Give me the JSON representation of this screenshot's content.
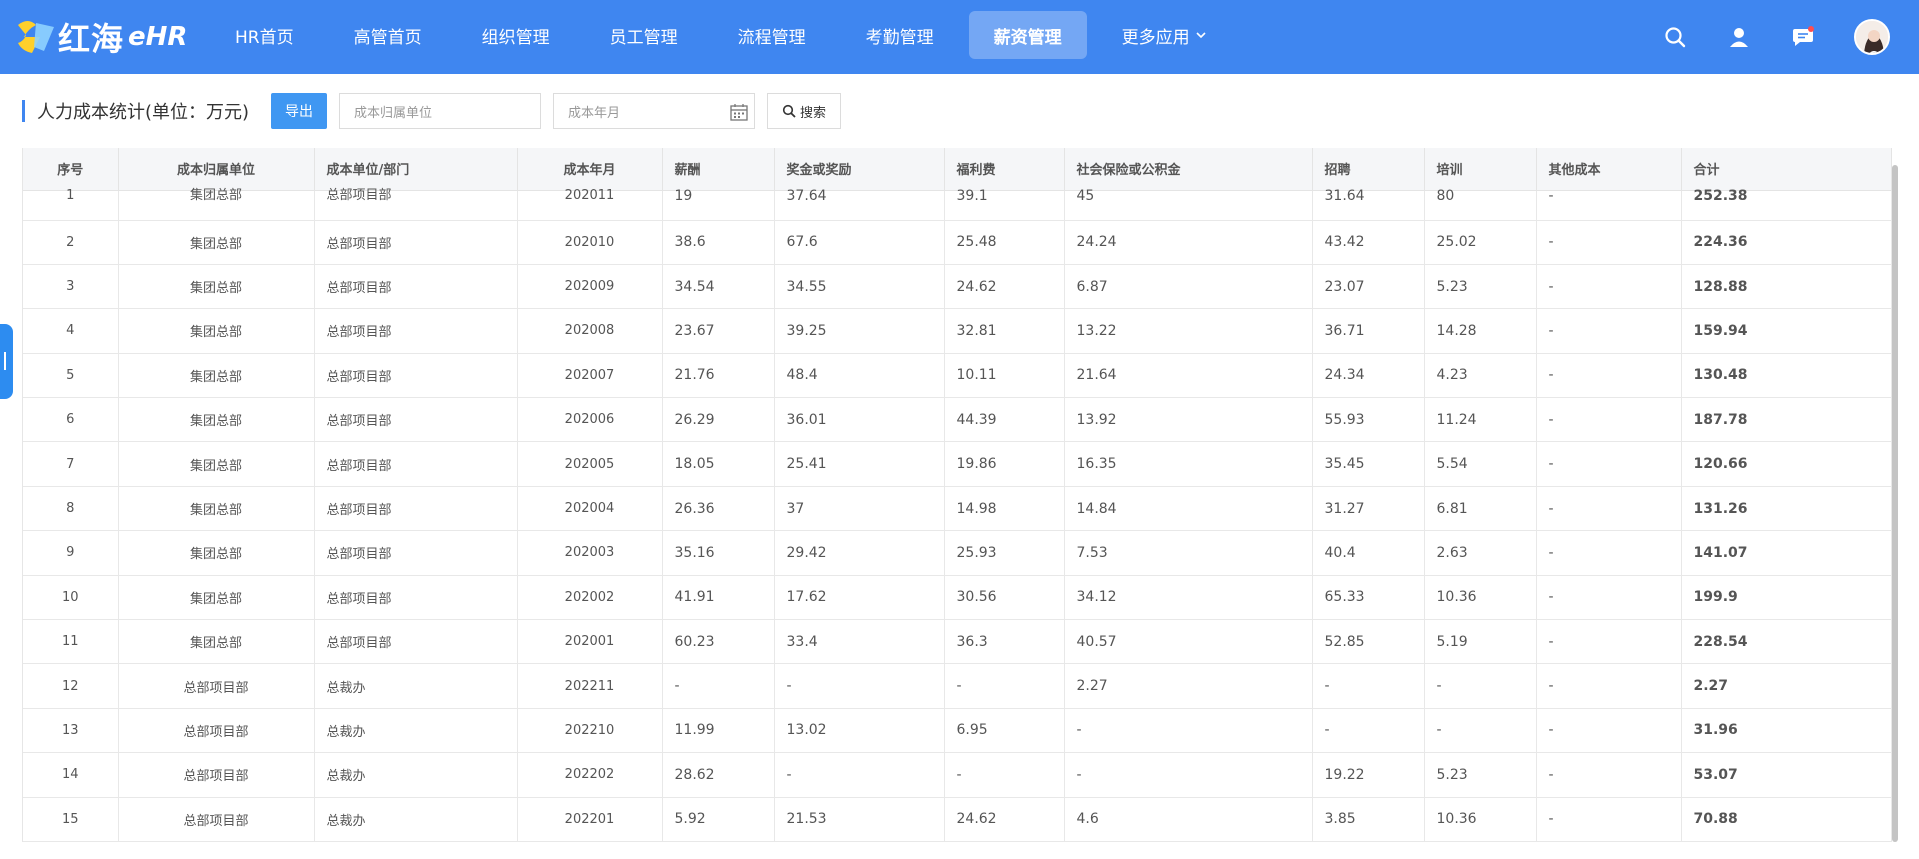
{
  "brand": {
    "name": "红海",
    "suffix": "eHR"
  },
  "nav": {
    "items": [
      {
        "label": "HR首页"
      },
      {
        "label": "高管首页"
      },
      {
        "label": "组织管理"
      },
      {
        "label": "员工管理"
      },
      {
        "label": "流程管理"
      },
      {
        "label": "考勤管理"
      },
      {
        "label": "薪资管理",
        "active": true
      },
      {
        "label": "更多应用"
      }
    ]
  },
  "header_icons": [
    "search-icon",
    "user-icon",
    "message-icon",
    "avatar"
  ],
  "toolbar": {
    "title": "人力成本统计(单位：万元)",
    "export_label": "导出",
    "unit_placeholder": "成本归属单位",
    "month_placeholder": "成本年月",
    "search_label": "搜索"
  },
  "table": {
    "headers": [
      "序号",
      "成本归属单位",
      "成本单位/部门",
      "成本年月",
      "薪酬",
      "奖金或奖励",
      "福利费",
      "社会保险或公积金",
      "招聘",
      "培训",
      "其他成本",
      "合计"
    ],
    "rows": [
      [
        "1",
        "集团总部",
        "总部项目部",
        "202011",
        "19",
        "37.64",
        "39.1",
        "45",
        "31.64",
        "80",
        "-",
        "252.38"
      ],
      [
        "2",
        "集团总部",
        "总部项目部",
        "202010",
        "38.6",
        "67.6",
        "25.48",
        "24.24",
        "43.42",
        "25.02",
        "-",
        "224.36"
      ],
      [
        "3",
        "集团总部",
        "总部项目部",
        "202009",
        "34.54",
        "34.55",
        "24.62",
        "6.87",
        "23.07",
        "5.23",
        "-",
        "128.88"
      ],
      [
        "4",
        "集团总部",
        "总部项目部",
        "202008",
        "23.67",
        "39.25",
        "32.81",
        "13.22",
        "36.71",
        "14.28",
        "-",
        "159.94"
      ],
      [
        "5",
        "集团总部",
        "总部项目部",
        "202007",
        "21.76",
        "48.4",
        "10.11",
        "21.64",
        "24.34",
        "4.23",
        "-",
        "130.48"
      ],
      [
        "6",
        "集团总部",
        "总部项目部",
        "202006",
        "26.29",
        "36.01",
        "44.39",
        "13.92",
        "55.93",
        "11.24",
        "-",
        "187.78"
      ],
      [
        "7",
        "集团总部",
        "总部项目部",
        "202005",
        "18.05",
        "25.41",
        "19.86",
        "16.35",
        "35.45",
        "5.54",
        "-",
        "120.66"
      ],
      [
        "8",
        "集团总部",
        "总部项目部",
        "202004",
        "26.36",
        "37",
        "14.98",
        "14.84",
        "31.27",
        "6.81",
        "-",
        "131.26"
      ],
      [
        "9",
        "集团总部",
        "总部项目部",
        "202003",
        "35.16",
        "29.42",
        "25.93",
        "7.53",
        "40.4",
        "2.63",
        "-",
        "141.07"
      ],
      [
        "10",
        "集团总部",
        "总部项目部",
        "202002",
        "41.91",
        "17.62",
        "30.56",
        "34.12",
        "65.33",
        "10.36",
        "-",
        "199.9"
      ],
      [
        "11",
        "集团总部",
        "总部项目部",
        "202001",
        "60.23",
        "33.4",
        "36.3",
        "40.57",
        "52.85",
        "5.19",
        "-",
        "228.54"
      ],
      [
        "12",
        "总部项目部",
        "总裁办",
        "202211",
        "-",
        "-",
        "-",
        "2.27",
        "-",
        "-",
        "-",
        "2.27"
      ],
      [
        "13",
        "总部项目部",
        "总裁办",
        "202210",
        "11.99",
        "13.02",
        "6.95",
        "-",
        "-",
        "-",
        "-",
        "31.96"
      ],
      [
        "14",
        "总部项目部",
        "总裁办",
        "202202",
        "28.62",
        "-",
        "-",
        "-",
        "19.22",
        "5.23",
        "-",
        "53.07"
      ],
      [
        "15",
        "总部项目部",
        "总裁办",
        "202201",
        "5.92",
        "21.53",
        "24.62",
        "4.6",
        "3.85",
        "10.36",
        "-",
        "70.88"
      ]
    ]
  },
  "colors": {
    "primary": "#3f86f0",
    "export": "#3f97f2"
  }
}
